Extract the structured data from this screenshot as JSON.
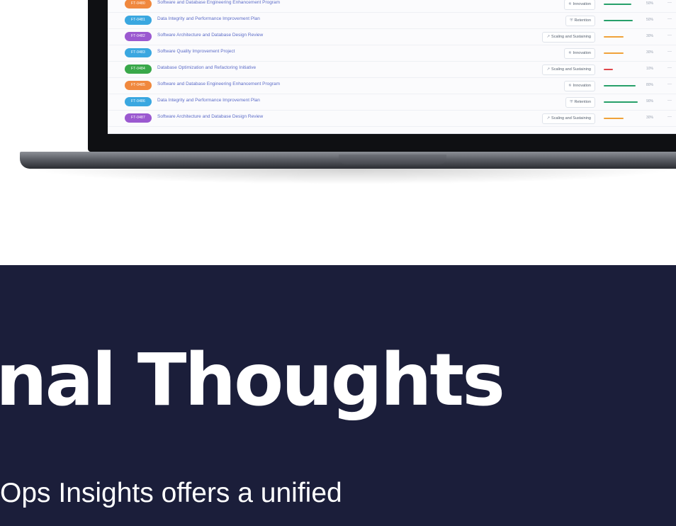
{
  "table_rows": [
    {
      "id": "FT-0480",
      "title": "Software and Database Engineering Enhancement Program",
      "tag": "Innovation",
      "tag_icon": "bulb-icon",
      "pct": "50%",
      "pill_color": "#f0883e",
      "bar_color": "#27a06a",
      "progress": 0.78
    },
    {
      "id": "FT-0481",
      "title": "Data Integrity and Performance Improvement Plan",
      "tag": "Retention",
      "tag_icon": "shield-icon",
      "pct": "50%",
      "pill_color": "#3aa7e0",
      "bar_color": "#27a06a",
      "progress": 0.82
    },
    {
      "id": "FT-0482",
      "title": "Software Architecture and Database Design Review",
      "tag": "Scaling and Sustaining",
      "tag_icon": "chart-icon",
      "pct": "30%",
      "pill_color": "#9b59d0",
      "bar_color": "#f0a23a",
      "progress": 0.55
    },
    {
      "id": "FT-0483",
      "title": "Software Quality Improvement Project",
      "tag": "Innovation",
      "tag_icon": "bulb-icon",
      "pct": "30%",
      "pill_color": "#3aa7e0",
      "bar_color": "#f0a23a",
      "progress": 0.55
    },
    {
      "id": "FT-0484",
      "title": "Database Optimization and Refactoring Initiative",
      "tag": "Scaling and Sustaining",
      "tag_icon": "chart-icon",
      "pct": "10%",
      "pill_color": "#39a84a",
      "bar_color": "#e0464b",
      "progress": 0.25
    },
    {
      "id": "FT-0485",
      "title": "Software and Database Engineering Enhancement Program",
      "tag": "Innovation",
      "tag_icon": "bulb-icon",
      "pct": "80%",
      "pill_color": "#f0883e",
      "bar_color": "#27a06a",
      "progress": 0.9
    },
    {
      "id": "FT-0486",
      "title": "Data Integrity and Performance Improvement Plan",
      "tag": "Retention",
      "tag_icon": "shield-icon",
      "pct": "90%",
      "pill_color": "#3aa7e0",
      "bar_color": "#27a06a",
      "progress": 0.95
    },
    {
      "id": "FT-0487",
      "title": "Software Architecture and Database Design Review",
      "tag": "Scaling and Sustaining",
      "tag_icon": "chart-icon",
      "pct": "30%",
      "pill_color": "#9b59d0",
      "bar_color": "#f0a23a",
      "progress": 0.55
    }
  ],
  "row_end_dash": "—",
  "section": {
    "heading": "nal Thoughts",
    "body": "Ops Insights offers a unified"
  },
  "colors": {
    "dark_background": "#1b1e3a",
    "heading_text": "#ffffff",
    "link_text": "#5c6cc8"
  }
}
